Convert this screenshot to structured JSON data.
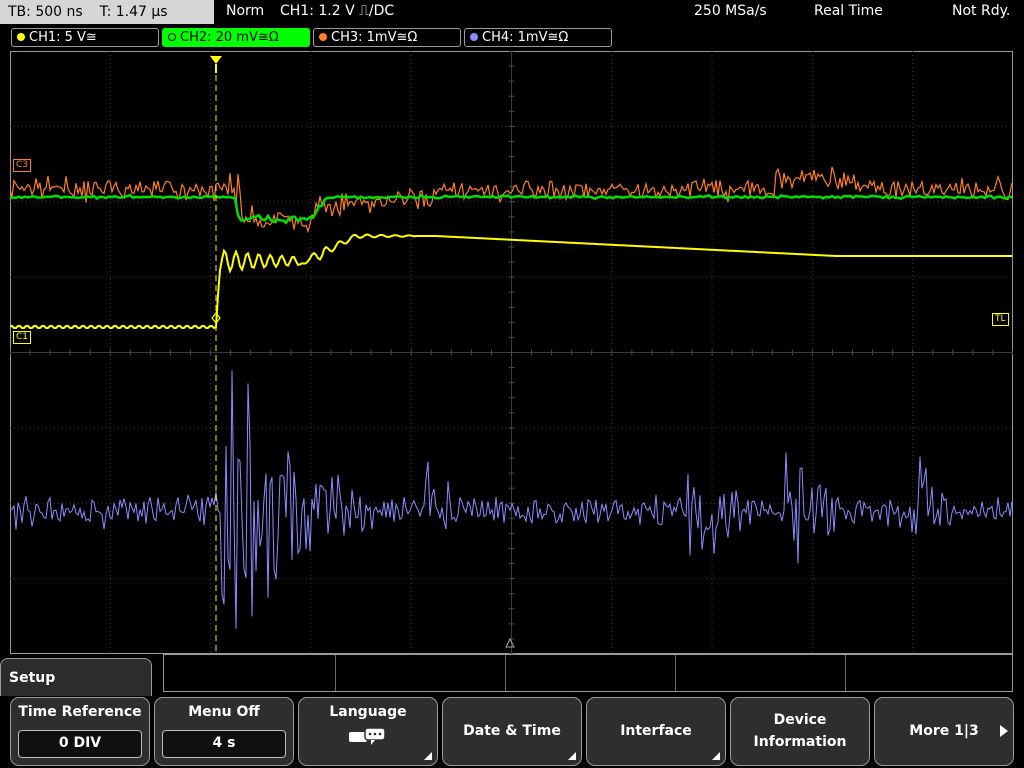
{
  "status": {
    "timebase": "TB: 500 ns",
    "trigger_time": "T: 1.47 µs",
    "trigger_mode": "Norm",
    "trigger_info": "CH1: 1.2 V ⎍/DC",
    "sample_rate": "250 MSa/s",
    "acq_mode": "Real Time",
    "ready_state": "Not Rdy."
  },
  "channels": [
    {
      "label": "CH1: 5 V≅",
      "color": "#ffff00"
    },
    {
      "label": "CH2: 20 mV≅Ω",
      "color": "#00ff00"
    },
    {
      "label": "CH3: 1mV≅Ω",
      "color": "#ff7f27"
    },
    {
      "label": "CH4: 1mV≅Ω",
      "color": "#8c8cff"
    }
  ],
  "markers": {
    "c1": "C1",
    "c3": "C3",
    "tl": "TL"
  },
  "menu": {
    "title": "Setup",
    "softkeys": [
      {
        "label": "Time Reference",
        "value": "0 DIV"
      },
      {
        "label": "Menu Off",
        "value": "4 s"
      },
      {
        "label": "Language",
        "icon": "speech-bubbles-icon"
      },
      {
        "label": "Date & Time"
      },
      {
        "label": "Interface"
      },
      {
        "label1": "Device",
        "label2": "Information"
      },
      {
        "label": "More 1|3",
        "icon": "next-page-icon"
      }
    ]
  }
}
